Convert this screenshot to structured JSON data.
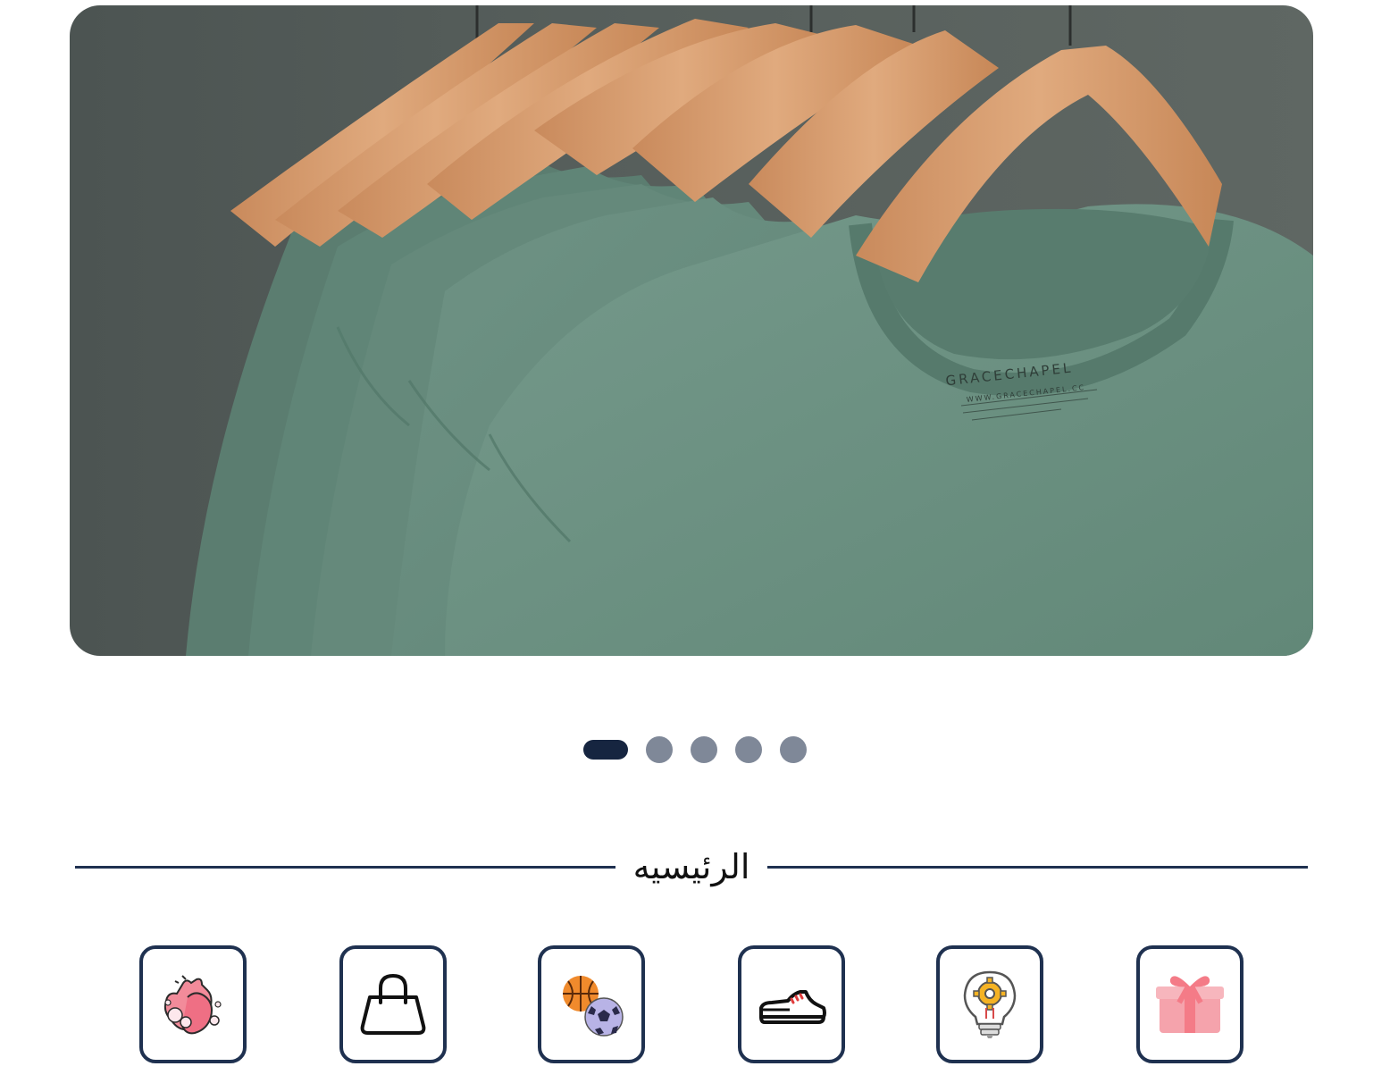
{
  "banner": {
    "shirt_label_brand": "GRACECHAPEL",
    "shirt_label_url": "WWW.GRACECHAPEL.CC"
  },
  "carousel": {
    "slide_count": 5,
    "active_index": 0
  },
  "section": {
    "title": "الرئيسيه"
  },
  "categories": [
    {
      "icon": "gift-icon"
    },
    {
      "icon": "lightbulb-gear-icon"
    },
    {
      "icon": "sneaker-icon"
    },
    {
      "icon": "sports-balls-icon"
    },
    {
      "icon": "shopping-bag-icon"
    },
    {
      "icon": "hand-washing-icon"
    }
  ],
  "colors": {
    "navy": "#1f3150",
    "dot_active": "#162540",
    "dot_inactive": "#7f8898",
    "shirt_green": "#6b8f80",
    "hanger_wood": "#d49a6a"
  }
}
